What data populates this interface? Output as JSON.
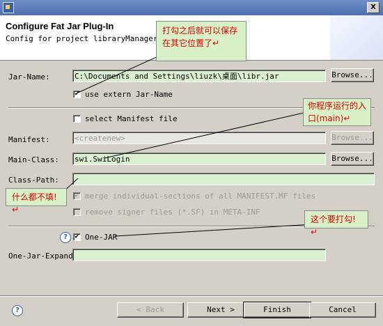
{
  "window": {
    "close_glyph": "X",
    "icon": "app-icon"
  },
  "header": {
    "title": "Configure Fat Jar Plug-In",
    "subtitle": "Config for project libraryManager"
  },
  "form": {
    "jar_name_label": "Jar-Name:",
    "jar_name_value": "C:\\Documents and Settings\\liuzk\\桌面\\libr.jar",
    "browse_label": "Browse...",
    "use_extern_label": "use extern Jar-Name",
    "use_extern_checked": true,
    "select_manifest_label": "select Manifest file",
    "select_manifest_checked": false,
    "manifest_label": "Manifest:",
    "manifest_value": "<createnew>",
    "main_class_label": "Main-Class:",
    "main_class_value": "swi.SwiLogin",
    "class_path_label": "Class-Path:",
    "class_path_value": "",
    "merge_label": "merge individual-sections of all MANIFEST.MF files",
    "merge_checked": true,
    "remove_signer_label": "remove signer files (*.SF) in META-INF",
    "remove_signer_checked": false,
    "one_jar_label": "One-JAR",
    "one_jar_checked": true,
    "one_jar_expand_label": "One-Jar-Expand:",
    "one_jar_expand_value": ""
  },
  "buttons": {
    "back": "< Back",
    "next": "Next >",
    "finish": "Finish",
    "cancel": "Cancel"
  },
  "annotations": {
    "callout_1": "打勾之后就可以保存在其它位置了↵",
    "callout_2": "你程序运行的入口(main)↵",
    "callout_3": "什么都不填!↵",
    "callout_4": "这个要打勾!↵",
    "color": "#e00000"
  },
  "colors": {
    "field_bg": "#d8f0d0",
    "header_bg": "#ffffff",
    "titlebar": "#4f6fb0"
  }
}
